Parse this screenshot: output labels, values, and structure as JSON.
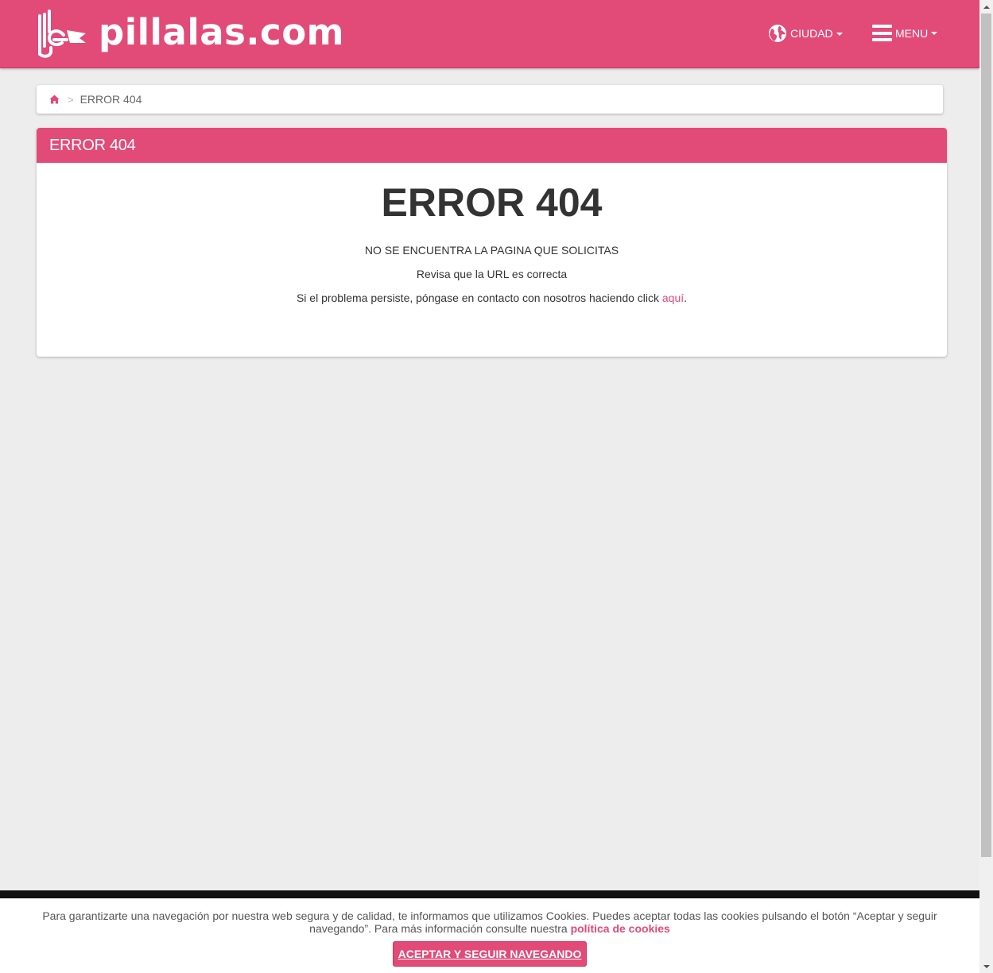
{
  "header": {
    "brand": "pillalas.com",
    "logo_icon": "hand-flag-logo-icon",
    "city_label": "CIUDAD",
    "city_icon": "globe-icon",
    "menu_label": "MENU",
    "menu_icon": "hamburger-icon"
  },
  "breadcrumb": {
    "home_icon": "home-icon",
    "separator": ">",
    "current": "ERROR 404"
  },
  "panel": {
    "heading": "ERROR 404",
    "title": "ERROR 404",
    "line1": "NO SE ENCUENTRA LA PAGINA QUE SOLICITAS",
    "line2": "Revisa que la URL es correcta",
    "line3_prefix": "Si el problema persiste, póngase en contacto con nosotros haciendo click ",
    "line3_link": "aquí",
    "line3_suffix": "."
  },
  "cookie": {
    "text": "Para garantizarte una navegación por nuestra web segura y de calidad, te informamos que utilizamos Cookies. Puedes aceptar todas las cookies pulsando el botón “Aceptar y seguir navegando”. Para más información consulte nuestra ",
    "link": "política de cookies",
    "button": "ACEPTAR Y SEGUIR NAVEGANDO"
  },
  "colors": {
    "brand_pink": "#e24a78",
    "background": "#ededed",
    "text_dark": "#333333"
  }
}
